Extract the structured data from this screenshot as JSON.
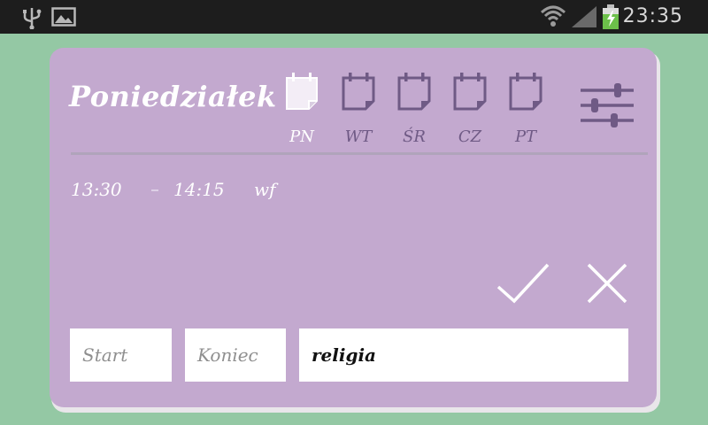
{
  "statusbar": {
    "time": "23:35",
    "icons": [
      "usb-icon",
      "image-icon",
      "wifi-icon",
      "signal-icon",
      "battery-charging-icon"
    ]
  },
  "header": {
    "title": "Poniedziałek",
    "days": [
      {
        "label": "PN",
        "active": true
      },
      {
        "label": "WT",
        "active": false
      },
      {
        "label": "ŚR",
        "active": false
      },
      {
        "label": "CZ",
        "active": false
      },
      {
        "label": "PT",
        "active": false
      }
    ],
    "settings_icon": "sliders-icon"
  },
  "entries": [
    {
      "start": "13:30",
      "end": "14:15",
      "subject": "wf"
    }
  ],
  "actions": {
    "confirm_icon": "checkmark-icon",
    "cancel_icon": "close-icon"
  },
  "form": {
    "start": {
      "value": "",
      "placeholder": "Start"
    },
    "end": {
      "value": "",
      "placeholder": "Koniec"
    },
    "subject": {
      "value": "religia",
      "placeholder": ""
    }
  },
  "colors": {
    "background": "#94c8a4",
    "card": "#c3a9cf",
    "accent": "#6f5a85",
    "statusbar": "#1d1d1d"
  }
}
